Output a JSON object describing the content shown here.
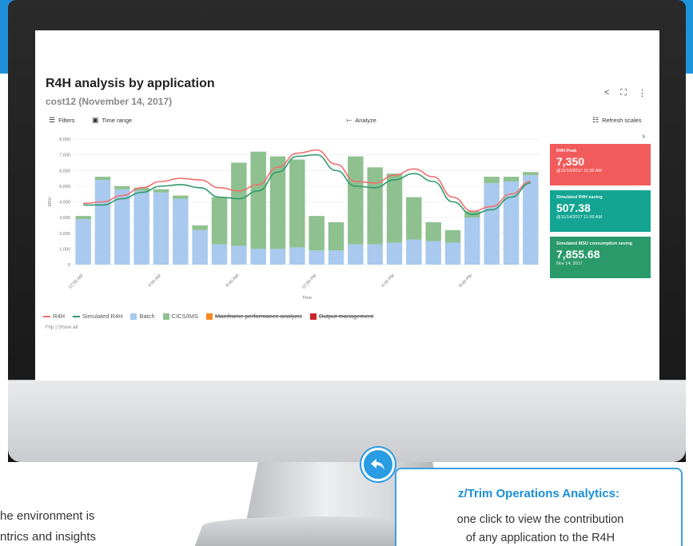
{
  "page": {
    "left_text": [
      "he environment is",
      "ntrics and insights"
    ]
  },
  "report": {
    "title": "R4H analysis by application",
    "subtitle": "cost12 (November 14, 2017)",
    "toolbar": {
      "filters_label": "Filters",
      "time_range_label": "Time range",
      "analyze_label": "Analyze",
      "refresh_label": "Refresh scales"
    },
    "flip_label": "Flip | Show all",
    "kpis": [
      {
        "label": "R4H Peak",
        "value": "7,350",
        "sub": "@11/14/2017 11:00 AM",
        "color": "#f25b5b"
      },
      {
        "label": "Simulated R4H saving",
        "value": "507.38",
        "sub": "@11/14/2017 11:00 AM",
        "color": "#13a592"
      },
      {
        "label": "Simulated MSU consumption saving",
        "value": "7,855.68",
        "sub": "Nov 14, 2017",
        "color": "#2b9a6a"
      }
    ]
  },
  "chart_data": {
    "type": "bar",
    "ylabel": "MSU",
    "xlabel": "Time",
    "ylim": [
      0,
      8000
    ],
    "yticks": [
      "0",
      "1,000",
      "2,000",
      "3,000",
      "4,000",
      "5,000",
      "6,000",
      "7,000",
      "8,000"
    ],
    "x_tick_labels": [
      {
        "index": 0,
        "label": "12:00 AM"
      },
      {
        "index": 4,
        "label": "4:00 AM"
      },
      {
        "index": 8,
        "label": "8:00 AM"
      },
      {
        "index": 12,
        "label": "12:00 PM"
      },
      {
        "index": 16,
        "label": "4:00 PM"
      },
      {
        "index": 20,
        "label": "8:00 PM"
      }
    ],
    "stacked_series": [
      {
        "name": "Batch",
        "color": "#a9c9ee",
        "values": [
          2900,
          5400,
          4800,
          4700,
          4600,
          4200,
          2200,
          1300,
          1200,
          1000,
          1000,
          1100,
          900,
          900,
          1300,
          1300,
          1400,
          1600,
          1500,
          1400,
          3000,
          5200,
          5300,
          5700
        ]
      },
      {
        "name": "CICS/IMS",
        "color": "#8ec18f",
        "values": [
          200,
          200,
          200,
          200,
          200,
          200,
          300,
          3000,
          5300,
          6200,
          5900,
          5600,
          2200,
          1800,
          5600,
          4900,
          4400,
          2700,
          1200,
          800,
          400,
          400,
          300,
          200
        ]
      }
    ],
    "line_series": [
      {
        "name": "R4H",
        "color": "#f07070",
        "values": [
          3900,
          4000,
          4400,
          4900,
          5300,
          5500,
          5400,
          4900,
          4700,
          5100,
          6200,
          7100,
          7300,
          6400,
          5300,
          5200,
          5700,
          6100,
          5600,
          4300,
          3400,
          3700,
          4500,
          5300
        ]
      },
      {
        "name": "Simulated R4H",
        "color": "#2f9a6e",
        "values": [
          3800,
          3800,
          4200,
          4600,
          5000,
          5100,
          4900,
          4300,
          4200,
          4700,
          5900,
          6900,
          7000,
          6000,
          5000,
          4900,
          5400,
          5800,
          5300,
          4000,
          3200,
          3500,
          4300,
          5200
        ]
      }
    ],
    "legend": [
      {
        "name": "R4H",
        "color": "#f07070",
        "kind": "line",
        "struck": false
      },
      {
        "name": "Simulated R4H",
        "color": "#2f9a6e",
        "kind": "line",
        "struck": false
      },
      {
        "name": "Batch",
        "color": "#a9c9ee",
        "kind": "box",
        "struck": false
      },
      {
        "name": "CICS/IMS",
        "color": "#8ec18f",
        "kind": "box",
        "struck": false
      },
      {
        "name": "Mainframe performance analyzis",
        "color": "#f58a1f",
        "kind": "box",
        "struck": true
      },
      {
        "name": "Output management",
        "color": "#c9232b",
        "kind": "box",
        "struck": true
      }
    ],
    "legend_position": "bottom-left",
    "grid": true
  },
  "callout": {
    "title": "z/Trim Operations Analytics:",
    "body_lines": [
      "one click to view the contribution",
      "of any application to the R4H"
    ]
  }
}
